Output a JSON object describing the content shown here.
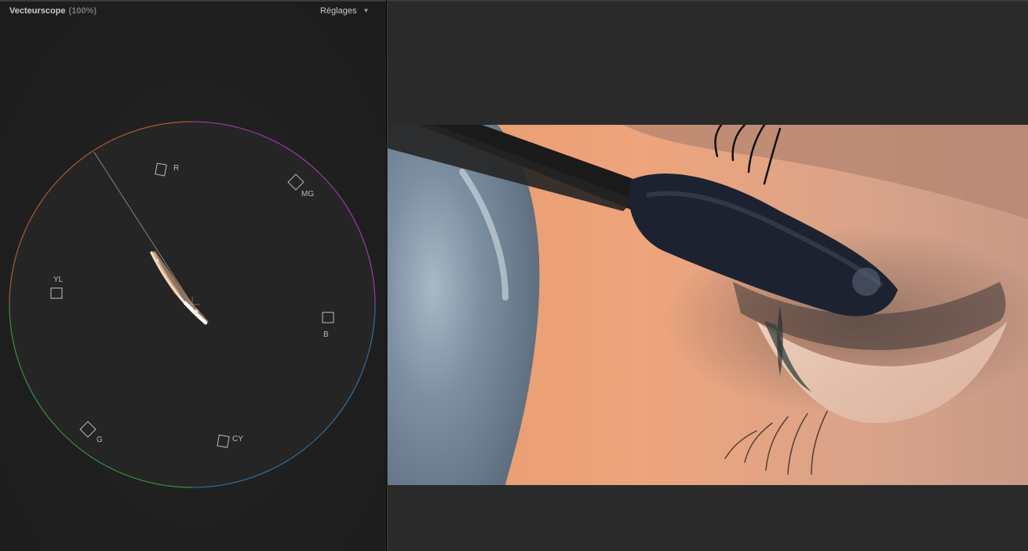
{
  "scope": {
    "title": "Vecteurscope",
    "zoom": "(100%)",
    "settings_label": "Réglages",
    "settings_caret": "▼",
    "targets": {
      "r": "R",
      "mg": "MG",
      "b": "B",
      "cy": "CY",
      "g": "G",
      "yl": "YL"
    }
  },
  "icons": {
    "settings_caret": "chevron-down-icon"
  }
}
